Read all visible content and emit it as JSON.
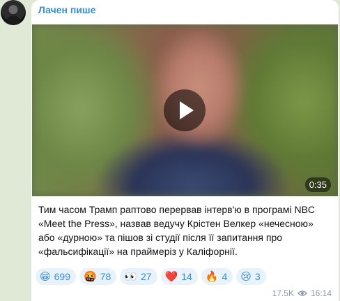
{
  "post": {
    "channel_name": "Лачен пише",
    "video": {
      "duration": "0:35"
    },
    "text": "Тим часом Трамп раптово перервав інтерв'ю в програмі NBC «Meet the Press», назвав ведучу Крістен Велкер «нечесною» або «дурною» та пішов зі студії після її запитання про «фальсифікації» на праймеріз у Каліфорнії.",
    "reactions": [
      {
        "icon": "grinning-face-icon",
        "emoji": "😁",
        "count": "699"
      },
      {
        "icon": "angry-face-icon",
        "emoji": "🤬",
        "count": "78"
      },
      {
        "icon": "eyes-icon",
        "emoji": "👀",
        "count": "27"
      },
      {
        "icon": "heart-icon",
        "emoji": "❤️",
        "count": "14"
      },
      {
        "icon": "fire-icon",
        "emoji": "🔥",
        "count": "4"
      },
      {
        "icon": "sad-face-icon",
        "emoji": "😢",
        "count": "3"
      }
    ],
    "views": "17.5K",
    "time": "16:14"
  },
  "colors": {
    "accent": "#3a8dd6",
    "background": "#dfe9d6",
    "reaction_bg": "#e8f2fb"
  }
}
